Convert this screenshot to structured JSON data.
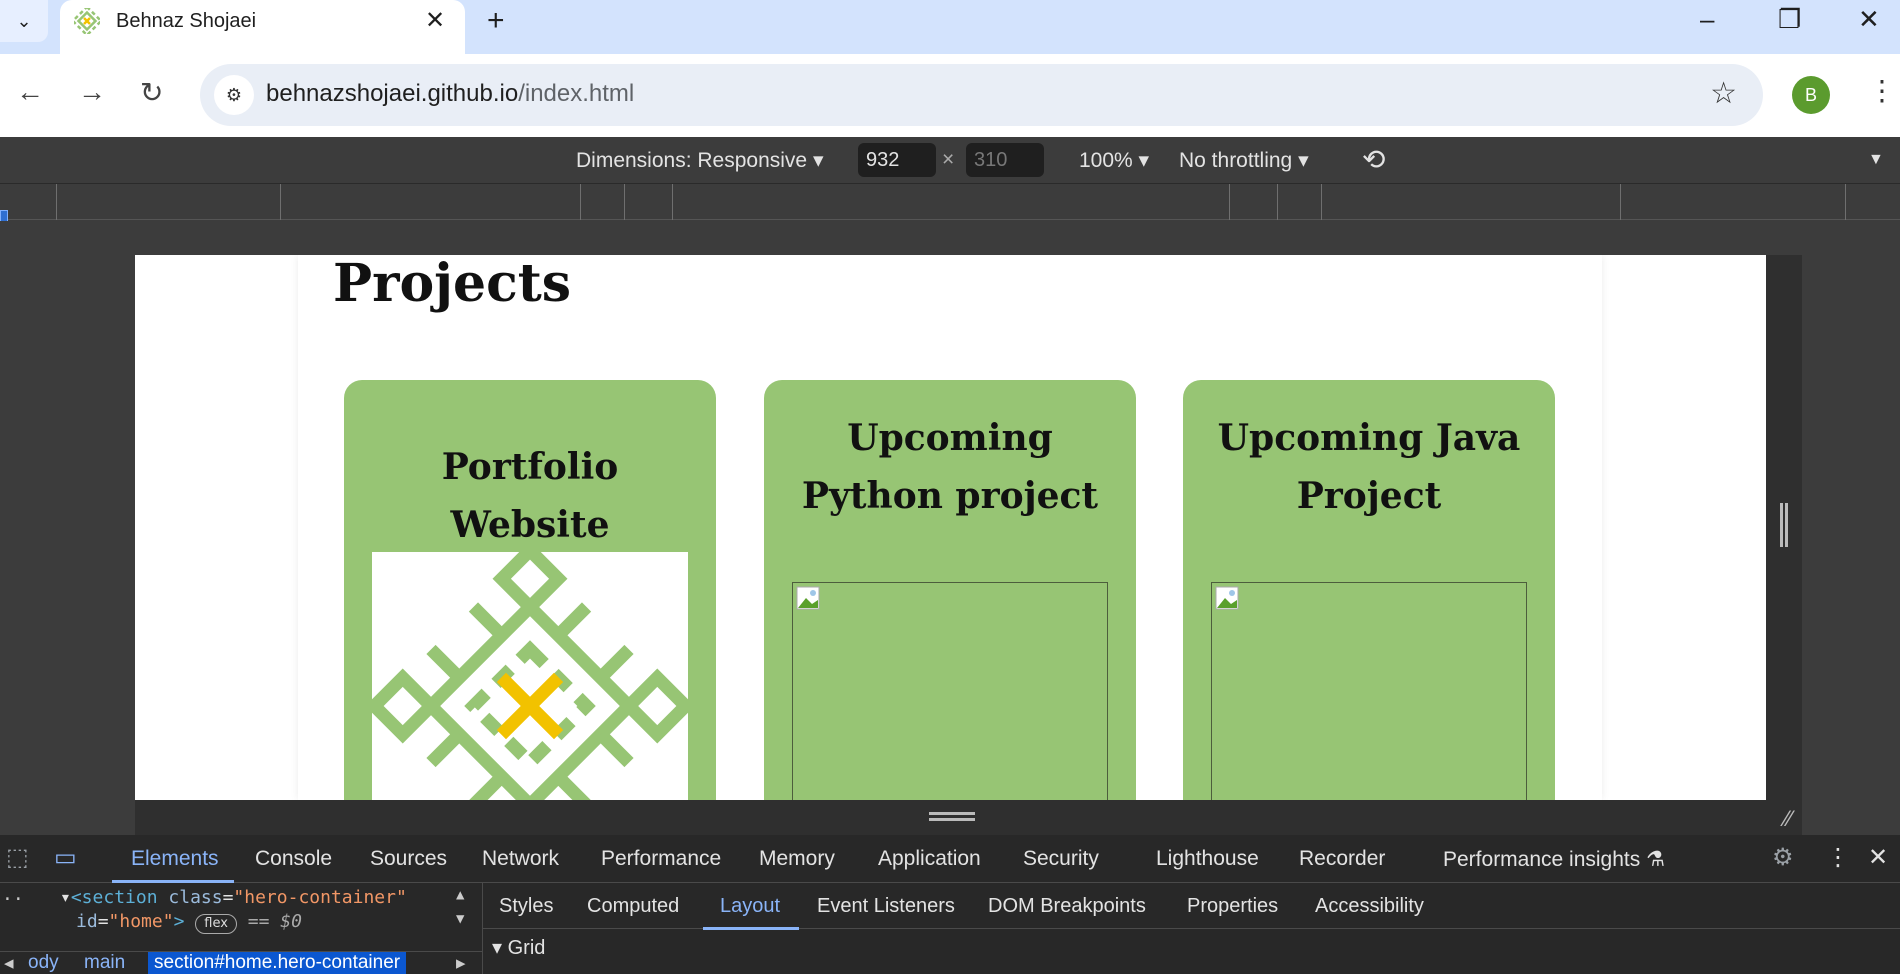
{
  "browser": {
    "tab_title": "Behnaz Shojaei",
    "tab_close": "✕",
    "new_tab": "+",
    "url_host": "behnazshojaei.github.io",
    "url_path": "/index.html",
    "profile_initial": "B"
  },
  "device_toolbar": {
    "dimensions_label": "Dimensions: Responsive",
    "width": "932",
    "times": "×",
    "height": "310",
    "zoom": "100%",
    "throttling": "No throttling"
  },
  "page": {
    "heading": "Projects",
    "cards": [
      {
        "title": "Portfolio Website"
      },
      {
        "title": "Upcoming Python project"
      },
      {
        "title": "Upcoming Java Project"
      }
    ],
    "colors": {
      "card_green": "#97c574",
      "logo_green": "#97c574",
      "logo_yellow": "#f2c200"
    }
  },
  "devtools": {
    "tabs": [
      "Elements",
      "Console",
      "Sources",
      "Network",
      "Performance",
      "Memory",
      "Application",
      "Security",
      "Lighthouse",
      "Recorder",
      "Performance insights"
    ],
    "active_tab": "Elements",
    "dom": {
      "tag_open": "<section",
      "class_attr": "class",
      "class_val": "\"hero-container\"",
      "id_attr": "id",
      "id_val": "\"home\"",
      "close": ">",
      "badge": "flex",
      "eq": "== $0"
    },
    "side_tabs": [
      "Styles",
      "Computed",
      "Layout",
      "Event Listeners",
      "DOM Breakpoints",
      "Properties",
      "Accessibility"
    ],
    "active_side_tab": "Layout",
    "section_label": "Grid",
    "breadcrumbs": [
      "ody",
      "main",
      "section#home.hero-container"
    ]
  }
}
